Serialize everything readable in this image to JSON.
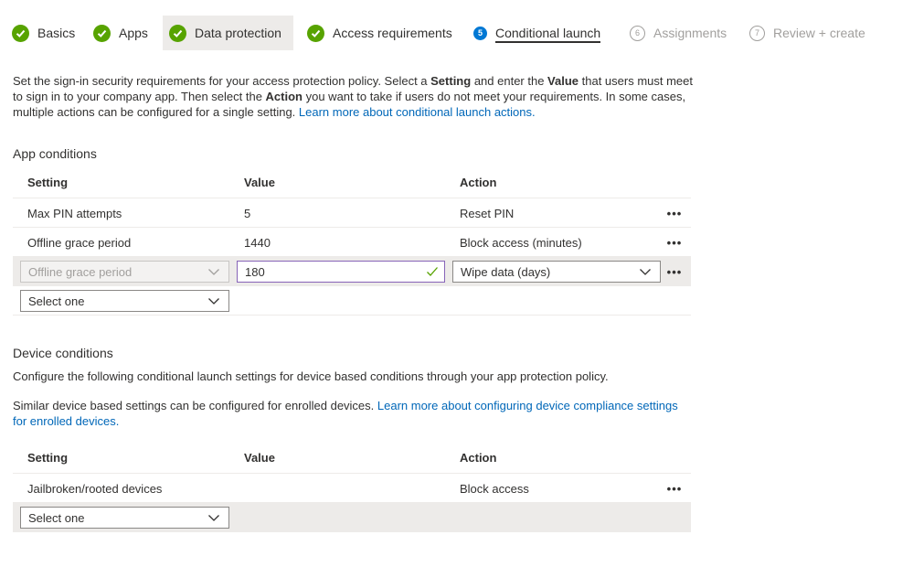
{
  "wizard": {
    "steps": [
      {
        "label": "Basics",
        "state": "done"
      },
      {
        "label": "Apps",
        "state": "done"
      },
      {
        "label": "Data protection",
        "state": "done"
      },
      {
        "label": "Access requirements",
        "state": "done"
      },
      {
        "label": "Conditional launch",
        "state": "current",
        "number": "5"
      },
      {
        "label": "Assignments",
        "state": "future",
        "number": "6"
      },
      {
        "label": "Review + create",
        "state": "future",
        "number": "7"
      }
    ]
  },
  "intro": {
    "p1": "Set the sign-in security requirements for your access protection policy. Select a ",
    "setting_word": "Setting",
    "p2": " and enter the ",
    "value_word": "Value",
    "p3": " that users must meet to sign in to your company app. Then select the ",
    "action_word": "Action",
    "p4": " you want to take if users do not meet your requirements. In some cases, multiple actions can be configured for a single setting. ",
    "link": "Learn more about conditional launch actions."
  },
  "app_conditions": {
    "title": "App conditions",
    "headers": {
      "setting": "Setting",
      "value": "Value",
      "action": "Action"
    },
    "rows": [
      {
        "setting": "Max PIN attempts",
        "value": "5",
        "action": "Reset PIN"
      },
      {
        "setting": "Offline grace period",
        "value": "1440",
        "action": "Block access (minutes)"
      }
    ],
    "edit_row": {
      "setting": "Offline grace period",
      "value": "180",
      "action": "Wipe data (days)"
    },
    "new_row": {
      "placeholder": "Select one"
    }
  },
  "device_conditions": {
    "title": "Device conditions",
    "desc1": "Configure the following conditional launch settings for device based conditions through your app protection policy.",
    "desc2": "Similar device based settings can be configured for enrolled devices. ",
    "link": "Learn more about configuring device compliance settings for enrolled devices.",
    "headers": {
      "setting": "Setting",
      "value": "Value",
      "action": "Action"
    },
    "rows": [
      {
        "setting": "Jailbroken/rooted devices",
        "value": "",
        "action": "Block access"
      }
    ],
    "new_row": {
      "placeholder": "Select one"
    }
  },
  "more_glyph": "•••",
  "colors": {
    "done": "#57a300",
    "current": "#0078d4",
    "link": "#0067b8",
    "focus": "#8764b8"
  }
}
